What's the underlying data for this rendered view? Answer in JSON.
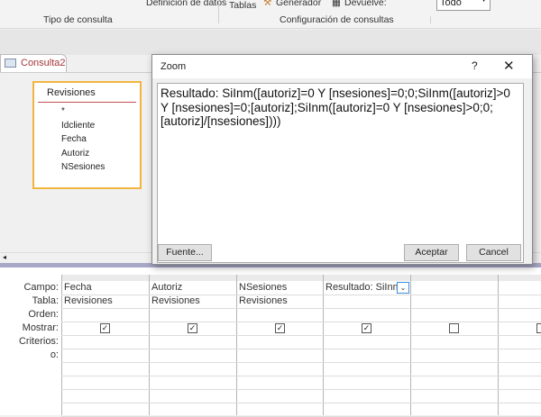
{
  "ribbon": {
    "data_definition": "Definición de datos",
    "query_type_group": "Tipo de consulta",
    "tables": "Tablas",
    "builder": "Generador",
    "returns_label": "Devuelve:",
    "returns_value": "Todo",
    "query_setup_group": "Configuración de consultas"
  },
  "document_tab": {
    "label": "Consulta2"
  },
  "table_box": {
    "title": "Revisiones",
    "fields": [
      "*",
      "Idcliente",
      "Fecha",
      "Autoriz",
      "NSesiones"
    ]
  },
  "grid": {
    "row_labels": [
      "Campo:",
      "Tabla:",
      "Orden:",
      "Mostrar:",
      "Criterios:",
      "o:"
    ],
    "columns": [
      {
        "field": "Fecha",
        "table": "Revisiones",
        "show": true
      },
      {
        "field": "Autoriz",
        "table": "Revisiones",
        "show": true
      },
      {
        "field": "NSesiones",
        "table": "Revisiones",
        "show": true
      },
      {
        "field": "Resultado: SiInm",
        "table": "",
        "show": true
      },
      {
        "field": "",
        "table": "",
        "show": false
      },
      {
        "field": "",
        "table": "",
        "show": false
      }
    ]
  },
  "zoom_dialog": {
    "title": "Zoom",
    "help": "?",
    "close": "✕",
    "expression": "Resultado: SiInm([autoriz]=0 Y [nsesiones]=0;0;SiInm([autoriz]>0 Y [nsesiones]=0;[autoriz];SiInm([autoriz]=0 Y [nsesiones]>0;0;[autoriz]/[nsesiones])))",
    "font_button": "Fuente...",
    "ok_button": "Aceptar",
    "cancel_button": "Cancel"
  }
}
